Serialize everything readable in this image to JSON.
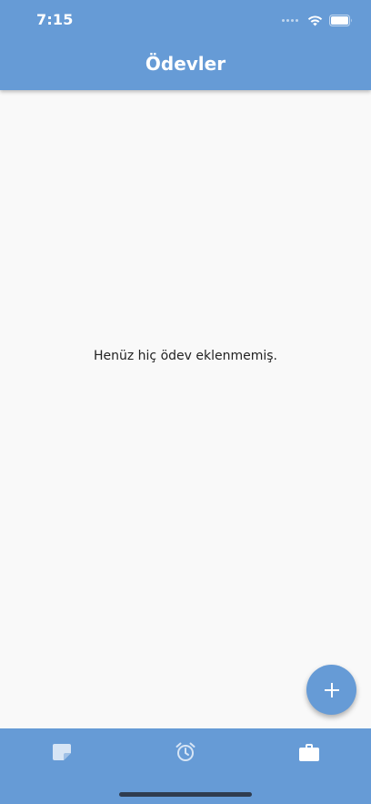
{
  "status_bar": {
    "time": "7:15",
    "icons": [
      "cellular-dots-icon",
      "wifi-icon",
      "battery-icon"
    ]
  },
  "header": {
    "title": "Ödevler",
    "background_color": "#669bd6"
  },
  "main": {
    "empty_message": "Henüz hiç ödev eklenmemiş."
  },
  "fab": {
    "icon": "plus-icon",
    "color": "#669bd6"
  },
  "bottom_nav": {
    "items": [
      {
        "icon": "note-icon",
        "active": false
      },
      {
        "icon": "alarm-clock-icon",
        "active": false
      },
      {
        "icon": "briefcase-icon",
        "active": true
      }
    ],
    "background_color": "#669bd6"
  }
}
